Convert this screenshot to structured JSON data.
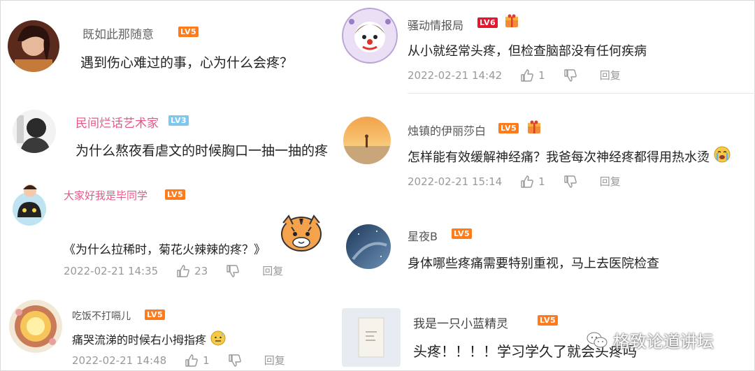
{
  "left": {
    "comments": [
      {
        "username": "既如此那随意",
        "level": "LV5",
        "text": "遇到伤心难过的事，心为什么会疼？"
      },
      {
        "username": "民间烂话艺术家",
        "level": "LV3",
        "text": "为什么熬夜看虐文的时候胸口一抽一抽的疼"
      },
      {
        "username": "大家好我是毕同学",
        "level": "LV5",
        "text": "《为什么拉稀时，菊花火辣辣的疼？》",
        "time": "2022-02-21 14:35",
        "likes": "23",
        "reply": "回复"
      },
      {
        "username": "吃饭不打嗝儿",
        "level": "LV5",
        "text": "痛哭流涕的时候右小拇指疼",
        "time": "2022-02-21 14:48",
        "likes": "1",
        "reply": "回复"
      }
    ]
  },
  "right": {
    "comments": [
      {
        "username": "骚动情报局",
        "level": "LV6",
        "text": "从小就经常头疼，但检查脑部没有任何疾病",
        "time": "2022-02-21 14:42",
        "likes": "1",
        "reply": "回复"
      },
      {
        "username": "烛镇的伊丽莎白",
        "level": "LV5",
        "text": "怎样能有效缓解神经痛？我爸每次神经疼都得用热水烫",
        "time": "2022-02-21 15:14",
        "likes": "1",
        "reply": "回复"
      },
      {
        "username": "星夜B",
        "level": "LV5",
        "text": "身体哪些疼痛需要特别重视，马上去医院检查"
      },
      {
        "username": "我是一只小蓝精灵",
        "level": "LV5",
        "text": "头疼！！！！学习学久了就会头疼吗"
      }
    ]
  },
  "watermark": {
    "text": "格致论道讲坛"
  },
  "colors": {
    "lv_orange": "#ff7b1c",
    "lv_red": "#e6162d",
    "lv_blue": "#7ec8f0",
    "pink_name": "#e8578a",
    "meta_gray": "#999999"
  },
  "icons": {
    "like": "thumbs-up-icon",
    "dislike": "thumbs-down-icon",
    "watermark": "wechat-icon"
  }
}
